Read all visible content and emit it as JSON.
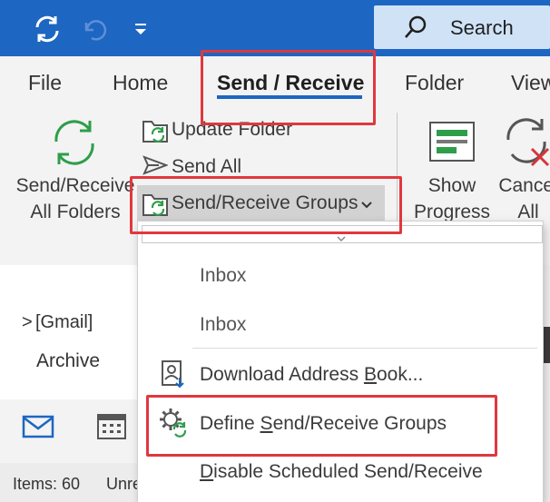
{
  "titlebar": {
    "search_label": "Search",
    "icons": [
      "sync-icon",
      "undo-icon",
      "customize-quick-access-icon",
      "search-icon"
    ]
  },
  "tabs": [
    {
      "label": "File"
    },
    {
      "label": "Home"
    },
    {
      "label": "Send / Receive",
      "active": true
    },
    {
      "label": "Folder"
    },
    {
      "label": "View"
    }
  ],
  "ribbon": {
    "send_receive_all": {
      "line1": "Send/Receive",
      "line2": "All Folders"
    },
    "update_folder": "Update Folder",
    "send_all": "Send All",
    "send_receive_groups": "Send/Receive Groups",
    "show_progress": {
      "line1": "Show",
      "line2": "Progress"
    },
    "cancel_all": {
      "line1": "Cancel",
      "line2": "All"
    }
  },
  "folders": {
    "gmail": "[Gmail]",
    "gmail_chevron": ">",
    "archive": "Archive"
  },
  "status": {
    "items": "Items: 60",
    "unread": "Unre"
  },
  "menu": {
    "items": [
      {
        "label": "Inbox"
      },
      {
        "label": "Inbox"
      },
      {
        "label_pre": "Download Address ",
        "label_ul": "B",
        "label_post": "ook..."
      },
      {
        "label_pre": "Define ",
        "label_ul": "S",
        "label_post": "end/Receive Groups"
      },
      {
        "label_pre": "",
        "label_ul": "D",
        "label_post": "isable Scheduled Send/Receive"
      }
    ]
  },
  "colors": {
    "accent": "#1d66c2",
    "highlight": "#e0383e",
    "sync_green": "#2e9e4a"
  }
}
